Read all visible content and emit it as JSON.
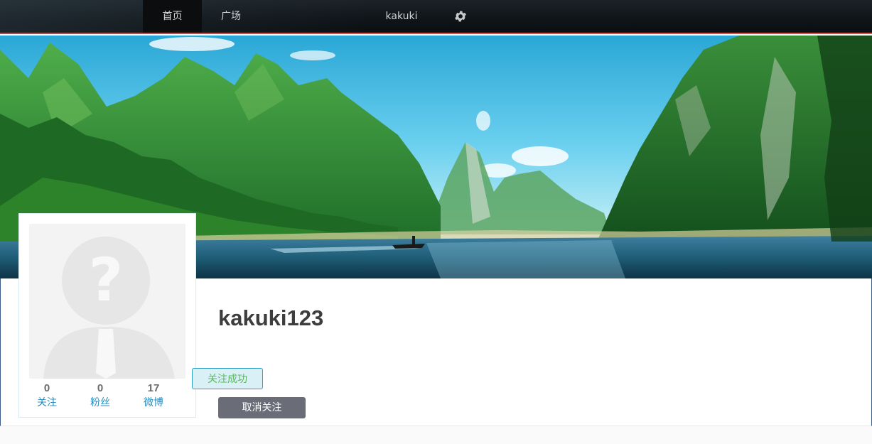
{
  "nav": {
    "home_label": "首页",
    "square_label": "广场",
    "username_label": "kakuki",
    "settings_icon": "gear-icon"
  },
  "profile": {
    "username": "kakuki123",
    "avatar_icon": "default-avatar-question-icon",
    "stats": {
      "following_count": "0",
      "following_label": "关注",
      "fans_count": "0",
      "fans_label": "粉丝",
      "posts_count": "17",
      "posts_label": "微博"
    },
    "follow_status": "关注成功",
    "unfollow_label": "取消关注"
  },
  "colors": {
    "nav_accent": "#d9534f",
    "link_blue": "#2a8dbd",
    "success_green": "#5cb85c",
    "button_gray": "#6a6d78"
  }
}
